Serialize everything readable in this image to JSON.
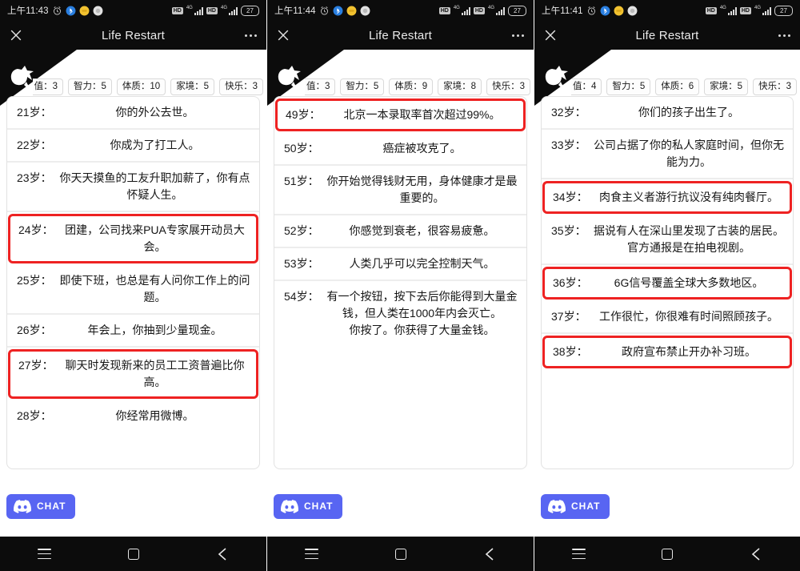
{
  "app": {
    "title": "Life Restart",
    "close_icon": "close-x-icon",
    "more_icon": "more-options-icon"
  },
  "chat": {
    "label": "CHAT",
    "icon": "discord-icon",
    "color": "#5865f2"
  },
  "navbar": {
    "recents_icon": "recents-menu-icon",
    "home_icon": "home-square-icon",
    "back_icon": "back-chevron-icon"
  },
  "statusbar_icons": {
    "alarm": "alarm-clock-icon",
    "bluetooth": "bluetooth-icon",
    "app1": "yellow-app-icon",
    "app2": "grey-app-icon",
    "hd": "hd-icon",
    "signal": "signal-bars-icon",
    "network": "4g-label"
  },
  "highlight_color": "#ee2222",
  "panels": [
    {
      "status": {
        "time": "上午11:43",
        "battery": "27",
        "net1": "4G",
        "net2": "4G",
        "hd": "HD"
      },
      "stats": [
        {
          "label": "颜值",
          "value": "3",
          "truncated": true
        },
        {
          "label": "智力",
          "value": "5",
          "truncated": false
        },
        {
          "label": "体质",
          "value": "10",
          "truncated": false
        },
        {
          "label": "家境",
          "value": "5",
          "truncated": false
        },
        {
          "label": "快乐",
          "value": "3",
          "truncated": false
        }
      ],
      "events": [
        {
          "age": "21岁：",
          "text": "你的外公去世。",
          "highlight": false
        },
        {
          "age": "22岁：",
          "text": "你成为了打工人。",
          "highlight": false
        },
        {
          "age": "23岁：",
          "text": "你天天摸鱼的工友升职加薪了，你有点怀疑人生。",
          "highlight": false
        },
        {
          "age": "24岁：",
          "text": "团建，公司找来PUA专家展开动员大会。",
          "highlight": true
        },
        {
          "age": "25岁：",
          "text": "即使下班，也总是有人问你工作上的问题。",
          "highlight": false
        },
        {
          "age": "26岁：",
          "text": "年会上，你抽到少量现金。",
          "highlight": false
        },
        {
          "age": "27岁：",
          "text": "聊天时发现新来的员工工资普遍比你高。",
          "highlight": true
        },
        {
          "age": "28岁：",
          "text": "你经常用微博。",
          "highlight": false
        }
      ]
    },
    {
      "status": {
        "time": "上午11:44",
        "battery": "27",
        "net1": "4G",
        "net2": "4G",
        "hd": "HD"
      },
      "stats": [
        {
          "label": "颜值",
          "value": "3",
          "truncated": true
        },
        {
          "label": "智力",
          "value": "5",
          "truncated": false
        },
        {
          "label": "体质",
          "value": "9",
          "truncated": false
        },
        {
          "label": "家境",
          "value": "8",
          "truncated": false
        },
        {
          "label": "快乐",
          "value": "3",
          "truncated": false
        }
      ],
      "events": [
        {
          "age": "49岁：",
          "text": "北京一本录取率首次超过99%。",
          "highlight": true
        },
        {
          "age": "50岁：",
          "text": "癌症被攻克了。",
          "highlight": false
        },
        {
          "age": "51岁：",
          "text": "你开始觉得钱财无用，身体健康才是最重要的。",
          "highlight": false
        },
        {
          "age": "52岁：",
          "text": "你感觉到衰老，很容易疲惫。",
          "highlight": false
        },
        {
          "age": "53岁：",
          "text": "人类几乎可以完全控制天气。",
          "highlight": false
        },
        {
          "age": "54岁：",
          "text": "有一个按钮，按下去后你能得到大量金钱，但人类在1000年内会灭亡。\n你按了。你获得了大量金钱。",
          "highlight": false
        }
      ]
    },
    {
      "status": {
        "time": "上午11:41",
        "battery": "27",
        "net1": "4G",
        "net2": "4G",
        "hd": "HD"
      },
      "stats": [
        {
          "label": "颜值",
          "value": "4",
          "truncated": true
        },
        {
          "label": "智力",
          "value": "5",
          "truncated": false
        },
        {
          "label": "体质",
          "value": "6",
          "truncated": false
        },
        {
          "label": "家境",
          "value": "5",
          "truncated": false
        },
        {
          "label": "快乐",
          "value": "3",
          "truncated": false
        }
      ],
      "events": [
        {
          "age": "32岁：",
          "text": "你们的孩子出生了。",
          "highlight": false
        },
        {
          "age": "33岁：",
          "text": "公司占据了你的私人家庭时间，但你无能为力。",
          "highlight": false
        },
        {
          "age": "34岁：",
          "text": "肉食主义者游行抗议没有纯肉餐厅。",
          "highlight": true
        },
        {
          "age": "35岁：",
          "text": "据说有人在深山里发现了古装的居民。官方通报是在拍电视剧。",
          "highlight": false
        },
        {
          "age": "36岁：",
          "text": "6G信号覆盖全球大多数地区。",
          "highlight": true
        },
        {
          "age": "37岁：",
          "text": "工作很忙，你很难有时间照顾孩子。",
          "highlight": false
        },
        {
          "age": "38岁：",
          "text": "政府宣布禁止开办补习班。",
          "highlight": true
        }
      ]
    }
  ]
}
